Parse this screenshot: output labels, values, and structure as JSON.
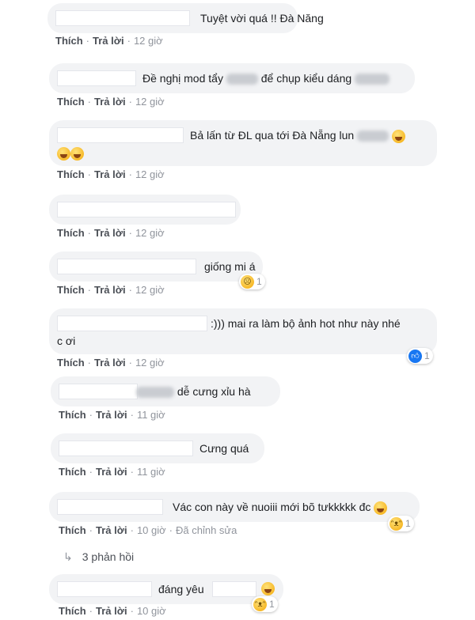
{
  "actions": {
    "like": "Thích",
    "reply": "Trả lời",
    "edited": "Đã chỉnh sửa"
  },
  "comments": [
    {
      "text": "Tuyệt vời quá !! Đà Năng",
      "time": "12 giờ"
    },
    {
      "text_a": "Đề nghị mod tẩy",
      "text_b": "để chụp kiểu dáng",
      "time": "12 giờ"
    },
    {
      "text": "Bả lấn từ ĐL qua tới Đà Nẵng lun",
      "time": "12 giờ"
    },
    {
      "text": "",
      "time": "12 giờ"
    },
    {
      "text": "giống mi á",
      "time": "12 giờ",
      "reaction_count": "1"
    },
    {
      "text_line1": ":))) mai ra làm bộ ảnh hot như này nhé",
      "text_line2": "c ơi",
      "time": "12 giờ",
      "reaction_count": "1"
    },
    {
      "text": "dễ cưng xỉu hà",
      "time": "11 giờ"
    },
    {
      "text": "Cưng quá",
      "time": "11 giờ"
    },
    {
      "text": "Vác con này về nuoiii mới bõ tưkkkkk đc",
      "time": "10 giờ",
      "reaction_count": "1"
    },
    {
      "text": "đáng yêu",
      "time": "10 giờ",
      "reaction_count": "1"
    }
  ],
  "replies_link": "3 phản hồi",
  "icons": {
    "laugh": "laughing-tears-emoji-icon",
    "sad": "sad-reaction-icon",
    "like": "like-reaction-icon",
    "smile": "smile-emoji-icon"
  }
}
